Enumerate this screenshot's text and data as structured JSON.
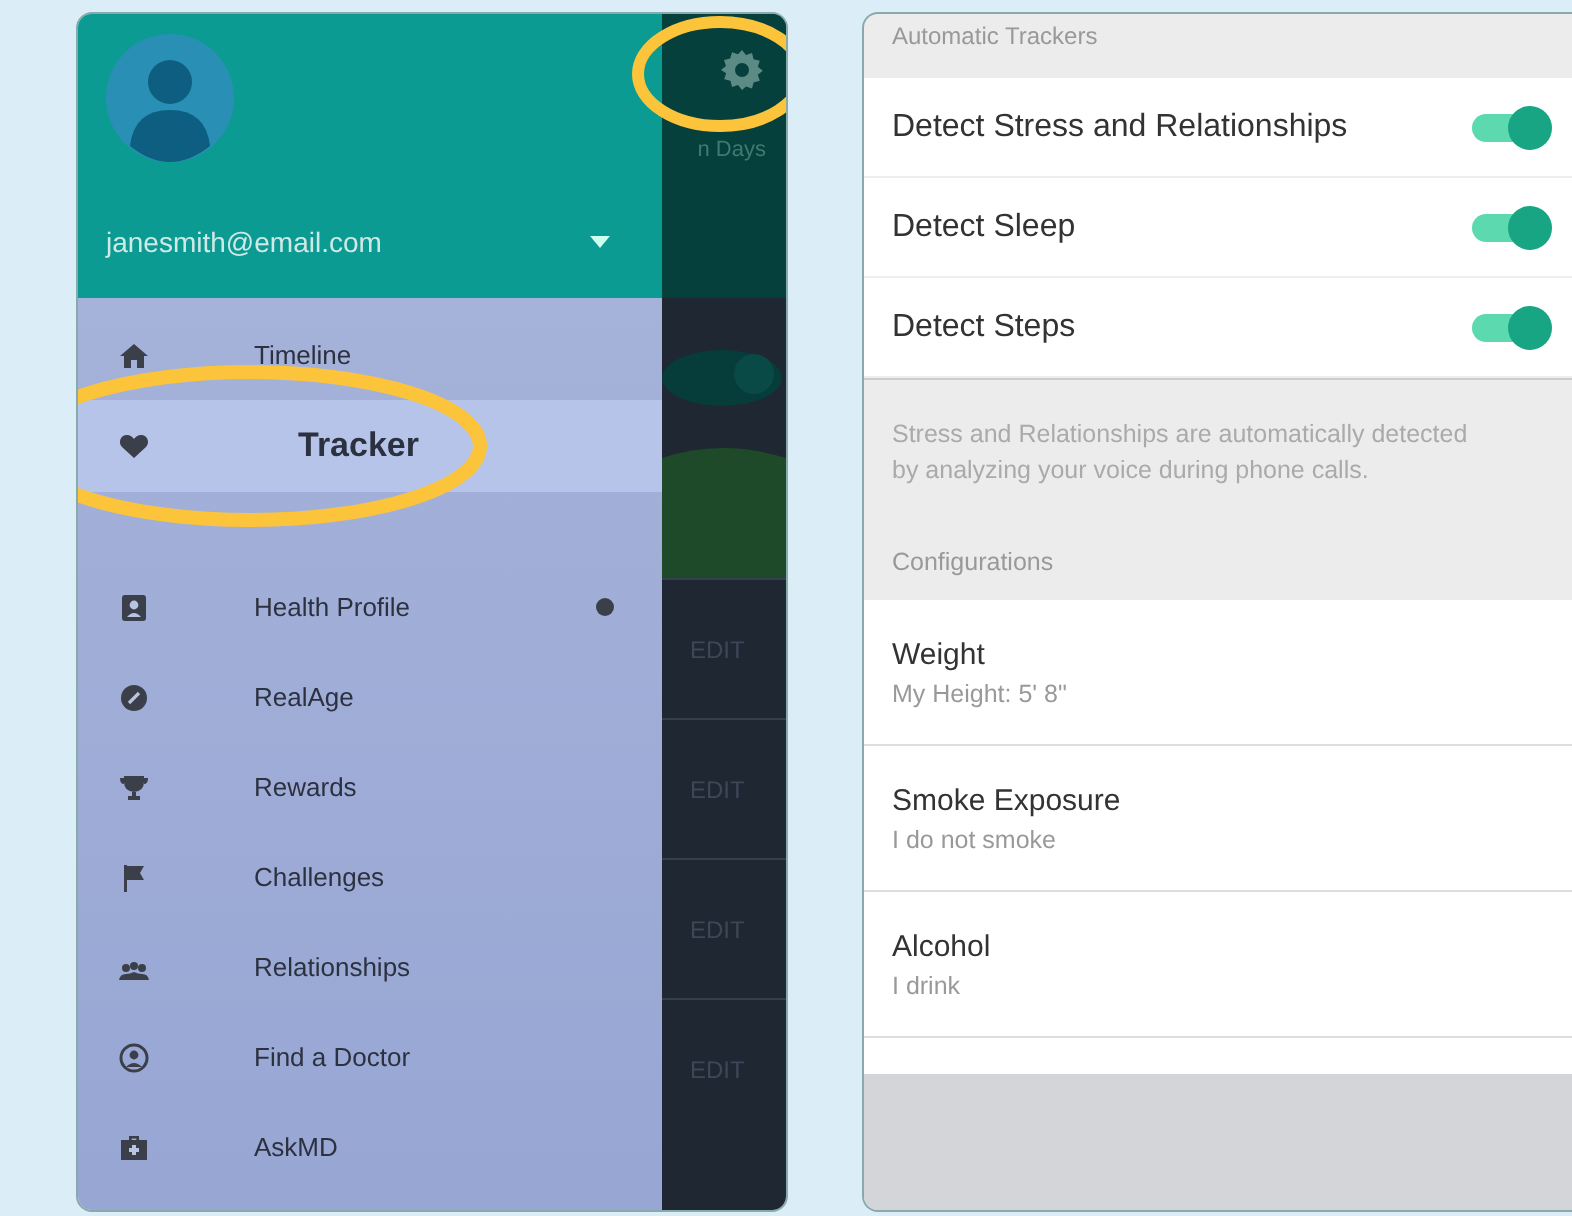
{
  "drawer": {
    "account_email": "janesmith@email.com",
    "items": [
      {
        "kind": "home",
        "label": "Timeline",
        "selected": false,
        "badge": false
      },
      {
        "kind": "heart",
        "label": "Tracker",
        "selected": true,
        "badge": false
      },
      {
        "kind": "profile",
        "label": "Health Profile",
        "selected": false,
        "badge": true
      },
      {
        "kind": "gauge",
        "label": "RealAge",
        "selected": false,
        "badge": false
      },
      {
        "kind": "trophy",
        "label": "Rewards",
        "selected": false,
        "badge": false
      },
      {
        "kind": "flag",
        "label": "Challenges",
        "selected": false,
        "badge": false
      },
      {
        "kind": "people",
        "label": "Relationships",
        "selected": false,
        "badge": false
      },
      {
        "kind": "person",
        "label": "Find a Doctor",
        "selected": false,
        "badge": false
      },
      {
        "kind": "kit",
        "label": "AskMD",
        "selected": false,
        "badge": false
      }
    ]
  },
  "background_screen": {
    "heading": "n Days",
    "edit_labels": [
      "EDIT",
      "EDIT",
      "EDIT",
      "EDIT"
    ]
  },
  "settings": {
    "automatic_trackers": {
      "heading": "Automatic Trackers",
      "toggles": [
        {
          "label": "Detect Stress and Relationships",
          "on": true
        },
        {
          "label": "Detect Sleep",
          "on": true
        },
        {
          "label": "Detect Steps",
          "on": true
        }
      ],
      "note": "Stress and Relationships are automatically detected by analyzing your voice during phone calls."
    },
    "configurations": {
      "heading": "Configurations",
      "items": [
        {
          "title": "Weight",
          "value": "My Height: 5' 8\""
        },
        {
          "title": "Smoke Exposure",
          "value": "I do not smoke"
        },
        {
          "title": "Alcohol",
          "value": "I drink"
        }
      ]
    }
  }
}
